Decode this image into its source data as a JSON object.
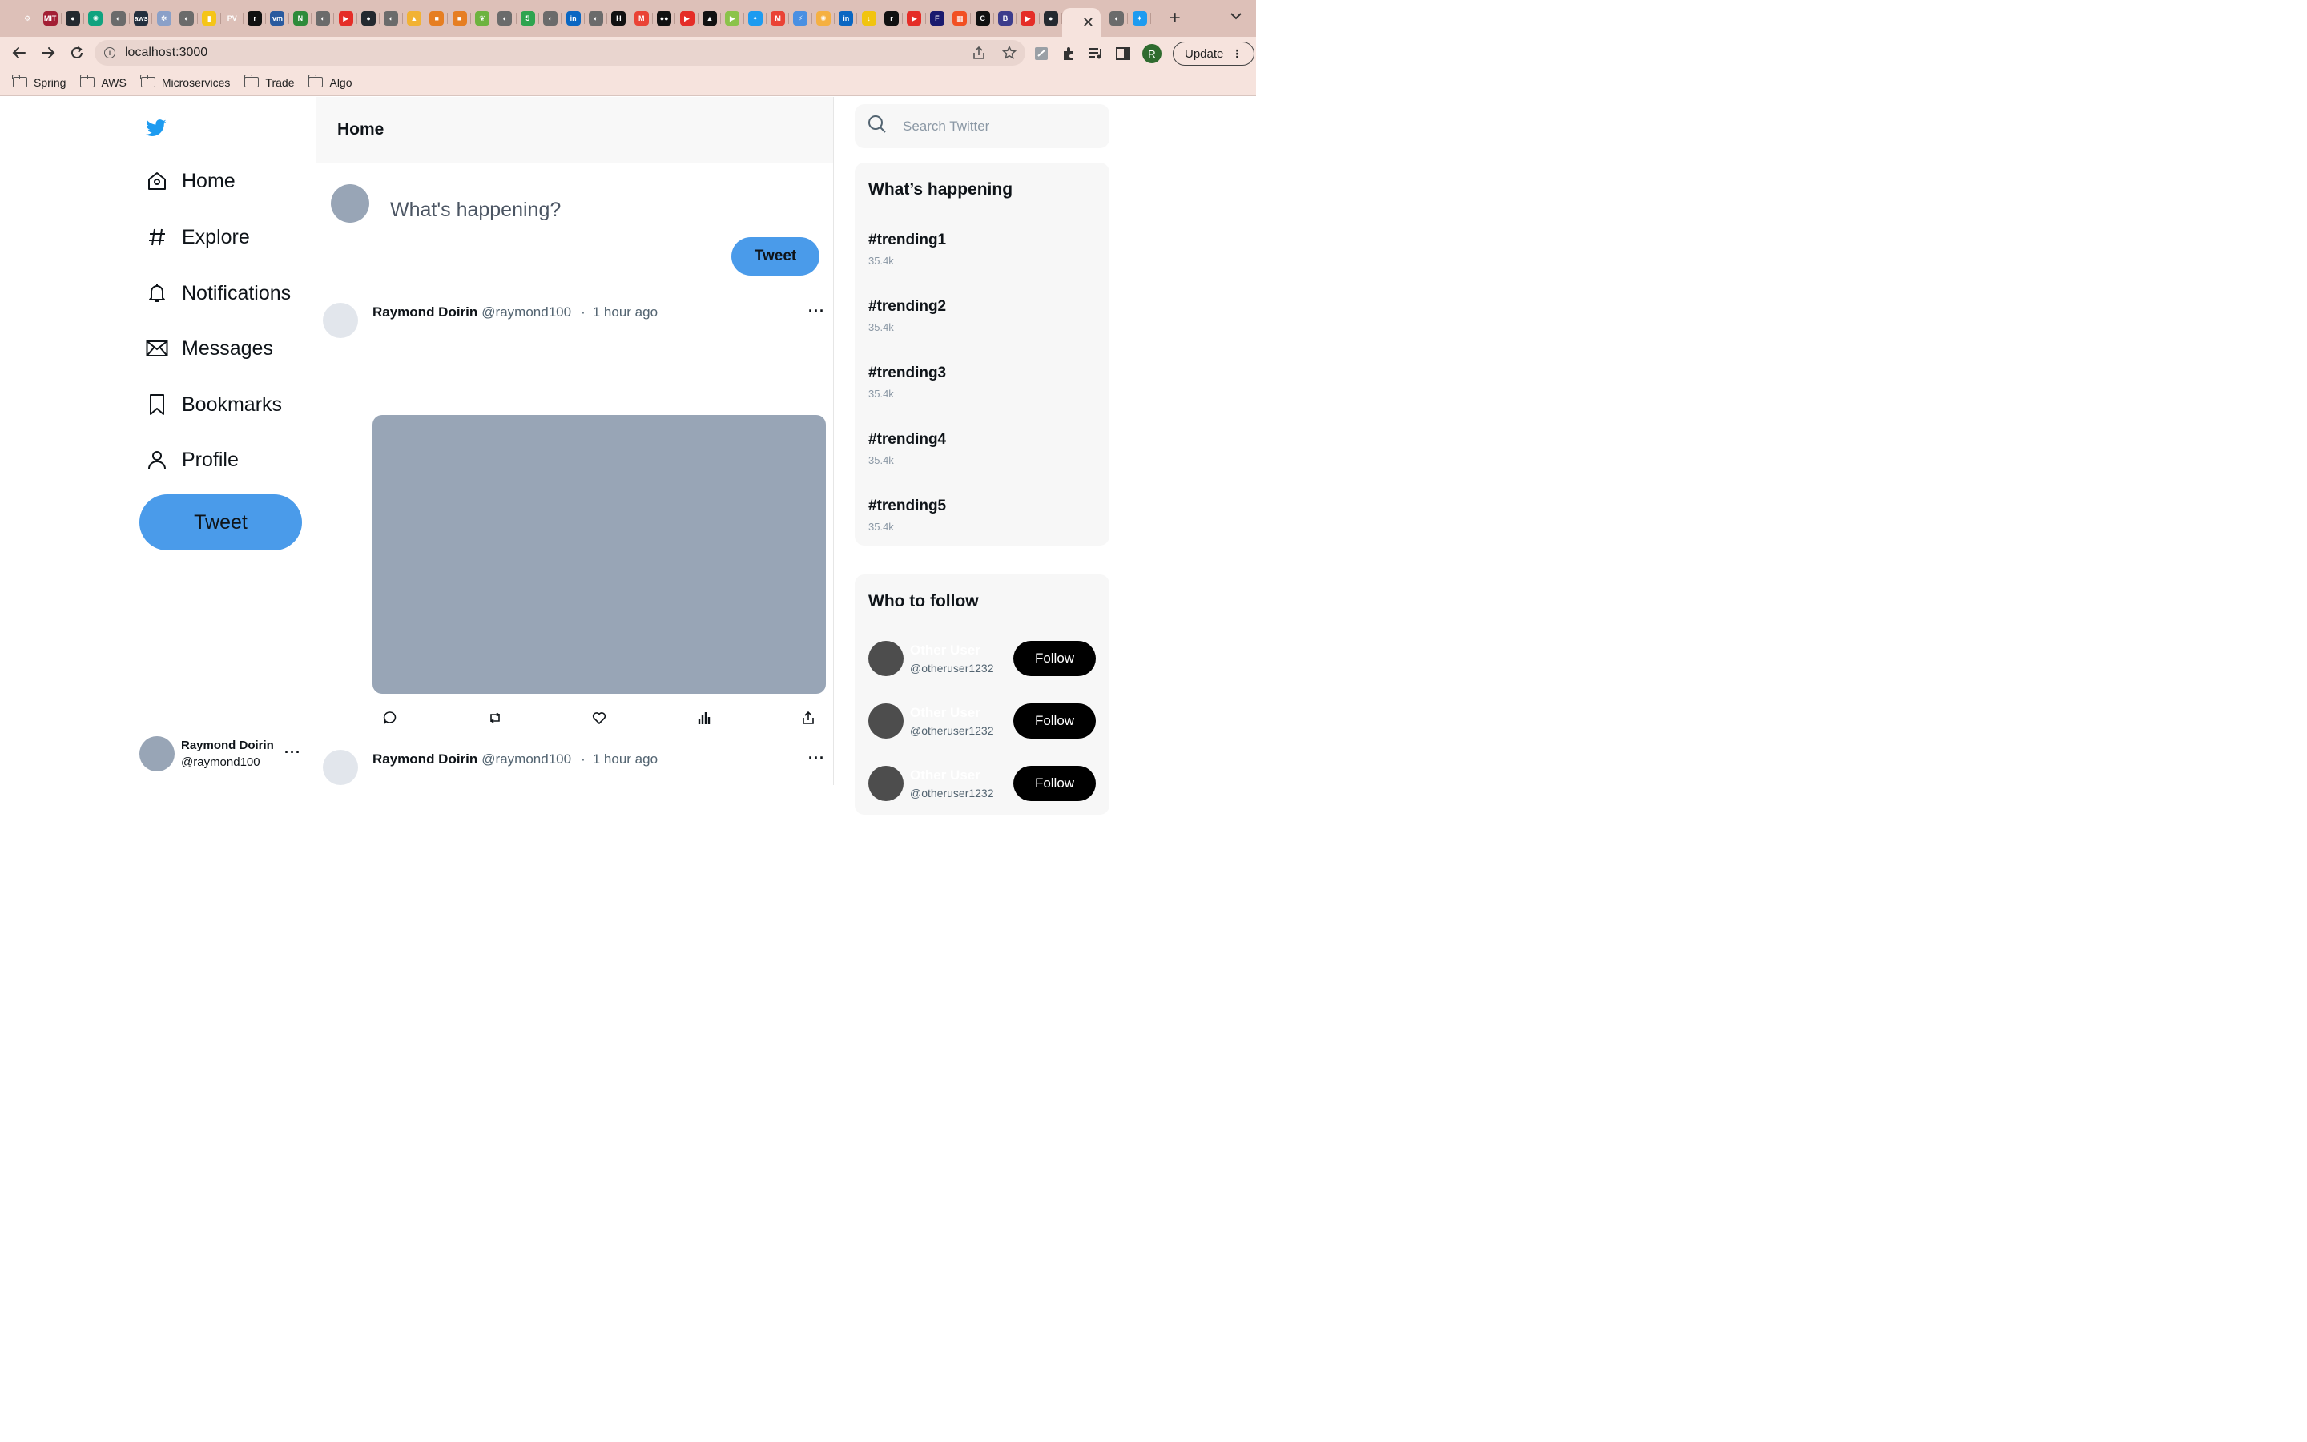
{
  "browser": {
    "tab_favicons": [
      {
        "name": "bike-tab-icon",
        "color": "#ddc0b8",
        "glyph": "⚙"
      },
      {
        "name": "mit-ocw-tab-icon",
        "color": "#a31f34",
        "glyph": "MIT"
      },
      {
        "name": "github-tab-icon",
        "color": "#24292f",
        "glyph": "●"
      },
      {
        "name": "openai-tab-icon",
        "color": "#10a37f",
        "glyph": "✺"
      },
      {
        "name": "globe-tab-icon",
        "color": "#6b6b6b",
        "glyph": "◐"
      },
      {
        "name": "aws-tab-icon",
        "color": "#232f3e",
        "glyph": "aws"
      },
      {
        "name": "settings-tab-icon",
        "color": "#8aa0c8",
        "glyph": "✲"
      },
      {
        "name": "globe-tab-icon",
        "color": "#6b6b6b",
        "glyph": "◐"
      },
      {
        "name": "note-tab-icon",
        "color": "#f5c518",
        "glyph": "▮"
      },
      {
        "name": "pv-tab-icon",
        "color": "#ddc0b8",
        "glyph": "PV"
      },
      {
        "name": "r-tab-icon",
        "color": "#111111",
        "glyph": "r"
      },
      {
        "name": "vmw-tab-icon",
        "color": "#2a5a9f",
        "glyph": "vm"
      },
      {
        "name": "n-tab-icon",
        "color": "#2e8b3a",
        "glyph": "N"
      },
      {
        "name": "globe-tab-icon",
        "color": "#6b6b6b",
        "glyph": "◐"
      },
      {
        "name": "youtube-tab-icon",
        "color": "#e52d27",
        "glyph": "▶"
      },
      {
        "name": "github-tab-icon",
        "color": "#24292f",
        "glyph": "●"
      },
      {
        "name": "globe-tab-icon",
        "color": "#6b6b6b",
        "glyph": "◐"
      },
      {
        "name": "drive-tab-icon",
        "color": "#f2b233",
        "glyph": "▲"
      },
      {
        "name": "box-tab-icon",
        "color": "#e67e22",
        "glyph": "■"
      },
      {
        "name": "box-tab-icon",
        "color": "#e67e22",
        "glyph": "■"
      },
      {
        "name": "spring-tab-icon",
        "color": "#6db33f",
        "glyph": "❦"
      },
      {
        "name": "globe-tab-icon",
        "color": "#6b6b6b",
        "glyph": "◐"
      },
      {
        "name": "five-tab-icon",
        "color": "#2ea44f",
        "glyph": "5"
      },
      {
        "name": "globe-tab-icon",
        "color": "#6b6b6b",
        "glyph": "◐"
      },
      {
        "name": "linkedin-tab-icon",
        "color": "#0a66c2",
        "glyph": "in"
      },
      {
        "name": "globe-tab-icon",
        "color": "#6b6b6b",
        "glyph": "◐"
      },
      {
        "name": "h-tab-icon",
        "color": "#111111",
        "glyph": "H"
      },
      {
        "name": "gmail-tab-icon",
        "color": "#ea4335",
        "glyph": "M"
      },
      {
        "name": "medium-tab-icon",
        "color": "#111111",
        "glyph": "●●"
      },
      {
        "name": "youtube-tab-icon",
        "color": "#e52d27",
        "glyph": "▶"
      },
      {
        "name": "graduation-tab-icon",
        "color": "#111111",
        "glyph": "▲"
      },
      {
        "name": "play-tab-icon",
        "color": "#8bc34a",
        "glyph": "▶"
      },
      {
        "name": "twitter-tab-icon",
        "color": "#1d9bf0",
        "glyph": "✦"
      },
      {
        "name": "gmail-tab-icon",
        "color": "#ea4335",
        "glyph": "M"
      },
      {
        "name": "bolt-tab-icon",
        "color": "#4a90e2",
        "glyph": "⚡"
      },
      {
        "name": "sun-tab-icon",
        "color": "#f5b041",
        "glyph": "✺"
      },
      {
        "name": "linkedin-tab-icon",
        "color": "#0a66c2",
        "glyph": "in"
      },
      {
        "name": "download-tab-icon",
        "color": "#f1c40f",
        "glyph": "↓"
      },
      {
        "name": "r-tab-icon",
        "color": "#111111",
        "glyph": "r"
      },
      {
        "name": "youtube-tab-icon",
        "color": "#e52d27",
        "glyph": "▶"
      },
      {
        "name": "f-tab-icon",
        "color": "#1a1a6e",
        "glyph": "F"
      },
      {
        "name": "microsoft-tab-icon",
        "color": "#f25022",
        "glyph": "▦"
      },
      {
        "name": "c-tab-icon",
        "color": "#111111",
        "glyph": "C"
      },
      {
        "name": "b-tab-icon",
        "color": "#3c3c8c",
        "glyph": "B"
      },
      {
        "name": "youtube-tab-icon",
        "color": "#e52d27",
        "glyph": "▶"
      },
      {
        "name": "github-tab-icon",
        "color": "#24292f",
        "glyph": "●"
      }
    ],
    "after_active_favicons": [
      {
        "name": "globe-tab-icon",
        "color": "#6b6b6b",
        "glyph": "◐"
      },
      {
        "name": "twitter-tab-icon",
        "color": "#1d9bf0",
        "glyph": "✦"
      }
    ],
    "active_tab_close": "✕",
    "new_tab": "+",
    "url": "localhost:3000",
    "profile_initial": "R",
    "update_label": "Update",
    "bookmarks": [
      "Spring",
      "AWS",
      "Microservices",
      "Trade",
      "Algo"
    ]
  },
  "sidebar": {
    "brand_color": "#1d9bf0",
    "nav": [
      {
        "label": "Home",
        "icon": "home-icon"
      },
      {
        "label": "Explore",
        "icon": "hashtag-icon"
      },
      {
        "label": "Notifications",
        "icon": "bell-icon"
      },
      {
        "label": "Messages",
        "icon": "envelope-icon"
      },
      {
        "label": "Bookmarks",
        "icon": "bookmark-icon"
      },
      {
        "label": "Profile",
        "icon": "person-icon"
      }
    ],
    "tweet_label": "Tweet",
    "account": {
      "name": "Raymond Doirin",
      "handle": "@raymond100",
      "more": "···"
    }
  },
  "feed": {
    "title": "Home",
    "composer": {
      "placeholder": "What's happening?",
      "tweet_label": "Tweet"
    },
    "posts": [
      {
        "name": "Raymond Doirin",
        "handle": "@raymond100",
        "separator": "·",
        "time": "1 hour ago",
        "more": "···"
      },
      {
        "name": "Raymond Doirin",
        "handle": "@raymond100",
        "separator": "·",
        "time": "1 hour ago",
        "more": "···"
      }
    ]
  },
  "right": {
    "search_placeholder": "Search Twitter",
    "trends_title": "What’s happening",
    "trends": [
      {
        "tag": "#trending1",
        "count": "35.4k"
      },
      {
        "tag": "#trending2",
        "count": "35.4k"
      },
      {
        "tag": "#trending3",
        "count": "35.4k"
      },
      {
        "tag": "#trending4",
        "count": "35.4k"
      },
      {
        "tag": "#trending5",
        "count": "35.4k"
      }
    ],
    "follow_title": "Who to follow",
    "suggestions": [
      {
        "name": "Other User",
        "handle": "@otheruser1232",
        "button": "Follow"
      },
      {
        "name": "Other User",
        "handle": "@otheruser1232",
        "button": "Follow"
      },
      {
        "name": "Other User",
        "handle": "@otheruser1232",
        "button": "Follow"
      }
    ]
  }
}
